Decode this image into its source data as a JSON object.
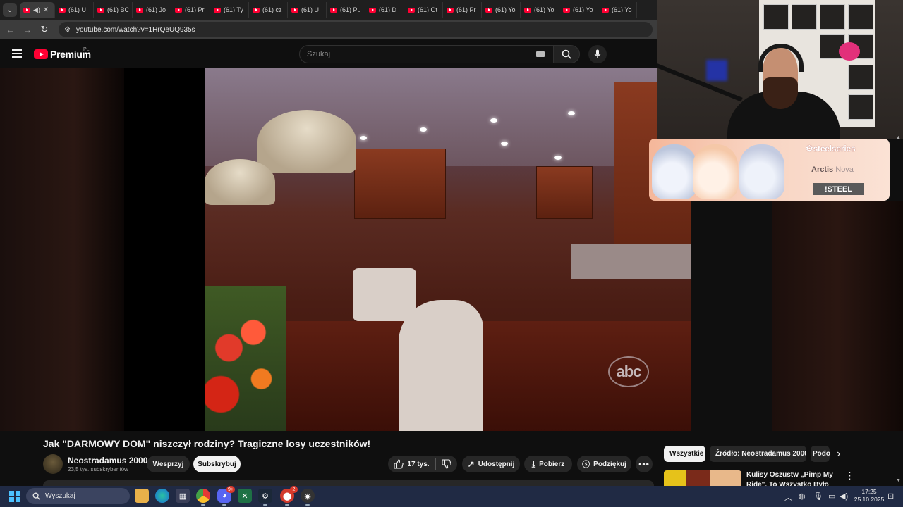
{
  "browser": {
    "tabs": [
      {
        "label": "(61) U"
      },
      {
        "label": "(61) BC"
      },
      {
        "label": "(61) Jo"
      },
      {
        "label": "(61) Pr"
      },
      {
        "label": "(61) Ty"
      },
      {
        "label": "(61) cz"
      },
      {
        "label": "(61) U"
      },
      {
        "label": "(61) Pu"
      },
      {
        "label": "(61) D"
      },
      {
        "label": "(61) Ot"
      },
      {
        "label": "(61) Pr"
      },
      {
        "label": "(61) Yo"
      },
      {
        "label": "(61) Yo"
      },
      {
        "label": "(61) Yo"
      },
      {
        "label": "(61) Yo"
      }
    ],
    "url": "youtube.com/watch?v=1HrQeUQ935s"
  },
  "youtube": {
    "logo_text": "Premium",
    "country_code": "PL",
    "search_placeholder": "Szukaj"
  },
  "video": {
    "title": "Jak \"DARMOWY DOM\" niszczył rodziny? Tragiczne losy uczestników!",
    "watermark": "abc",
    "channel_name": "Neostradamus 2000",
    "subscribers": "23,5 tys. subskrybentów",
    "support_label": "Wesprzyj",
    "subscribe_label": "Subskrybuj",
    "likes": "17 tys.",
    "share_label": "Udostępnij",
    "download_label": "Pobierz",
    "thanks_label": "Podziękuj"
  },
  "sponsor": {
    "brand": "steelseries",
    "product_a": "Arctis",
    "product_b": "Nova",
    "code": "!STEEL"
  },
  "recommendations": {
    "chips": [
      "Wszystkie",
      "Źródło: Neostradamus 2000",
      "Podo"
    ],
    "first_title": "Kulisy Oszustw „Pimp My Ride\". To Wszystko Było Ustawione!"
  },
  "taskbar": {
    "search_label": "Wyszukaj",
    "discord_badge": "9+",
    "app_badge": "2",
    "time": "17:25",
    "date": "25.10.2025"
  },
  "colors": {
    "youtube_red": "#ff0033",
    "background": "#0f0f0f",
    "taskbar": "#202a44",
    "windows_accent": "#4cc2ff"
  }
}
